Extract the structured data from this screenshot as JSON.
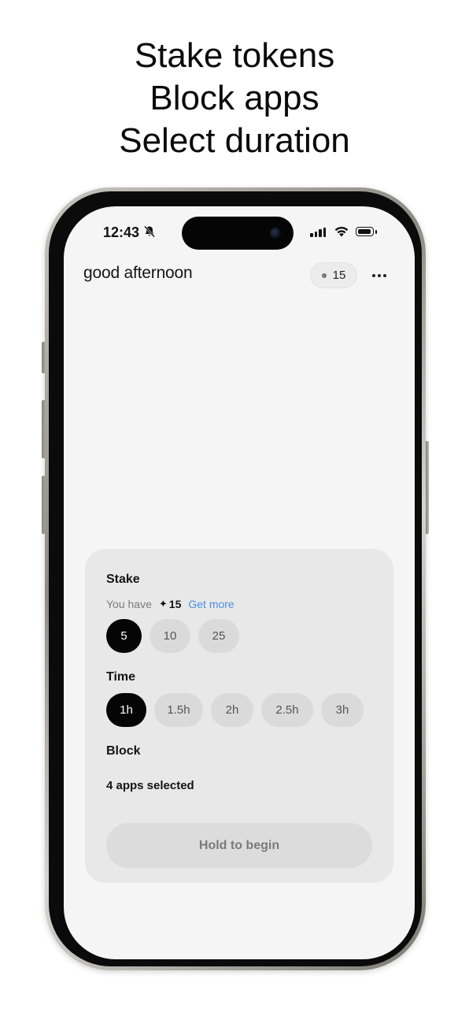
{
  "headline": {
    "line1": "Stake tokens",
    "line2": "Block apps",
    "line3": "Select duration"
  },
  "status_bar": {
    "time": "12:43",
    "icons": [
      "bell-slash-icon",
      "cellular-signal-icon",
      "wifi-icon",
      "battery-icon"
    ]
  },
  "header": {
    "greeting": "good afternoon",
    "token_count": "15",
    "more_icon": "ellipsis-icon"
  },
  "card": {
    "stake_label": "Stake",
    "you_have_label": "You have",
    "balance_icon": "sparkle-icon",
    "balance": "15",
    "get_more": "Get more",
    "stake_options": [
      "5",
      "10",
      "25"
    ],
    "stake_selected": "5",
    "time_label": "Time",
    "time_options": [
      "1h",
      "1.5h",
      "2h",
      "2.5h",
      "3h"
    ],
    "time_selected": "1h",
    "block_label": "Block",
    "apps_selected": "4 apps selected",
    "hold_button": "Hold to begin"
  },
  "colors": {
    "accent_link": "#4a90e2",
    "chip_selected": "#050505",
    "chip_default": "#dadada",
    "card_bg": "#e8e8e8",
    "screen_bg": "#f5f5f5"
  }
}
